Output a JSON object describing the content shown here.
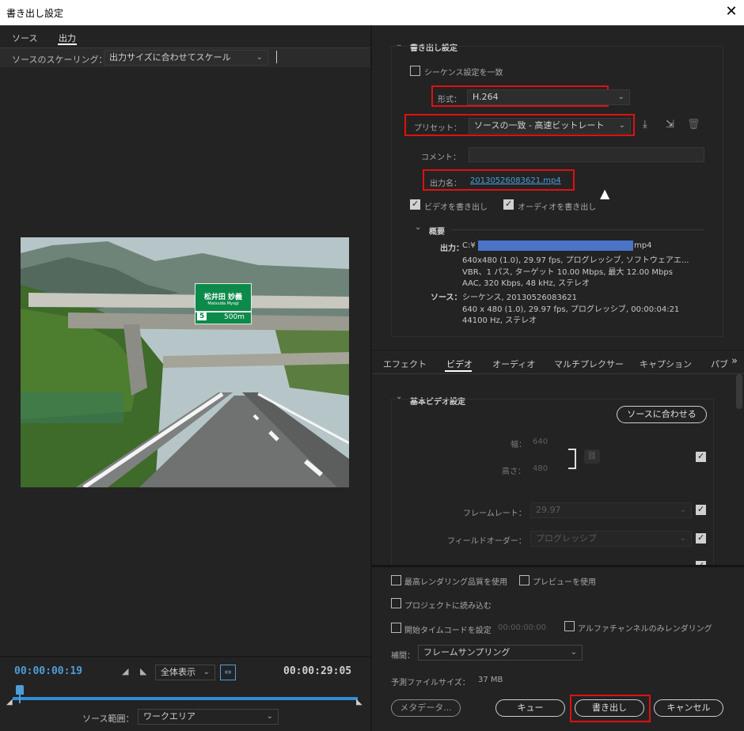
{
  "window": {
    "title": "書き出し設定",
    "close": "✕"
  },
  "left": {
    "tabs": [
      "ソース",
      "出力"
    ],
    "scaling_label": "ソースのスケーリング：",
    "scaling_value": "出力サイズに合わせてスケール",
    "sign_line1": "松井田  妙義",
    "sign_line2": "Matsuida  Myogi",
    "sign_num": "5",
    "sign_dist": "500m",
    "timecode_current": "00:00:00:19",
    "timecode_end": "00:00:29:05",
    "zoom_value": "全体表示",
    "source_range_label": "ソース範囲：",
    "source_range_value": "ワークエリア"
  },
  "export": {
    "section_title": "書き出し設定",
    "match_sequence": "シーケンス設定を一致",
    "format_label": "形式：",
    "format_value": "H.264",
    "preset_label": "プリセット：",
    "preset_value": "ソースの一致 - 高速ビットレート",
    "comment_label": "コメント：",
    "output_name_label": "出力名：",
    "output_name_value": "20130526083621.mp4",
    "export_video": "ビデオを書き出し",
    "export_audio": "オーディオを書き出し",
    "summary_title": "概要",
    "output_label": "出力：",
    "output_line1_prefix": "C:¥",
    "output_line1_suffix": "mp4",
    "output_line2": "640x480 (1.0), 29.97 fps, プログレッシブ, ソフトウェアエ...",
    "output_line3": "VBR、1 パス, ターゲット 10.00 Mbps, 最大 12.00 Mbps",
    "output_line4": "AAC, 320 Kbps, 48 kHz, ステレオ",
    "source_label": "ソース：",
    "source_line1": "シーケンス, 20130526083621",
    "source_line2": "640 x 480 (1.0), 29.97 fps, プログレッシブ, 00:00:04:21",
    "source_line3": "44100  Hz, ステレオ"
  },
  "tabs2": [
    "エフェクト",
    "ビデオ",
    "オーディオ",
    "マルチプレクサー",
    "キャプション",
    "パブ",
    "»"
  ],
  "video": {
    "section_title": "基本ビデオ設定",
    "match_source": "ソースに合わせる",
    "width_label": "幅：",
    "width_value": "640",
    "height_label": "高さ：",
    "height_value": "480",
    "framerate_label": "フレームレート：",
    "framerate_value": "29.97",
    "field_label": "フィールドオーダー：",
    "field_value": "プログレッシブ"
  },
  "bottom": {
    "max_quality": "最高レンダリング品質を使用",
    "use_preview": "プレビューを使用",
    "import_project": "プロジェクトに読み込む",
    "set_start_tc": "開始タイムコードを設定",
    "start_tc_value": "00:00:00:00",
    "alpha_only": "アルファチャンネルのみレンダリング",
    "interp_label": "補間：",
    "interp_value": "フレームサンプリング",
    "filesize_label": "予測ファイルサイズ：",
    "filesize_value": "37 MB",
    "metadata_btn": "メタデータ...",
    "queue_btn": "キュー",
    "export_btn": "書き出し",
    "cancel_btn": "キャンセル"
  },
  "colors": {
    "highlight_red": "#e01010",
    "accent_blue": "#4f9ed8",
    "panel_bg": "#232323"
  }
}
